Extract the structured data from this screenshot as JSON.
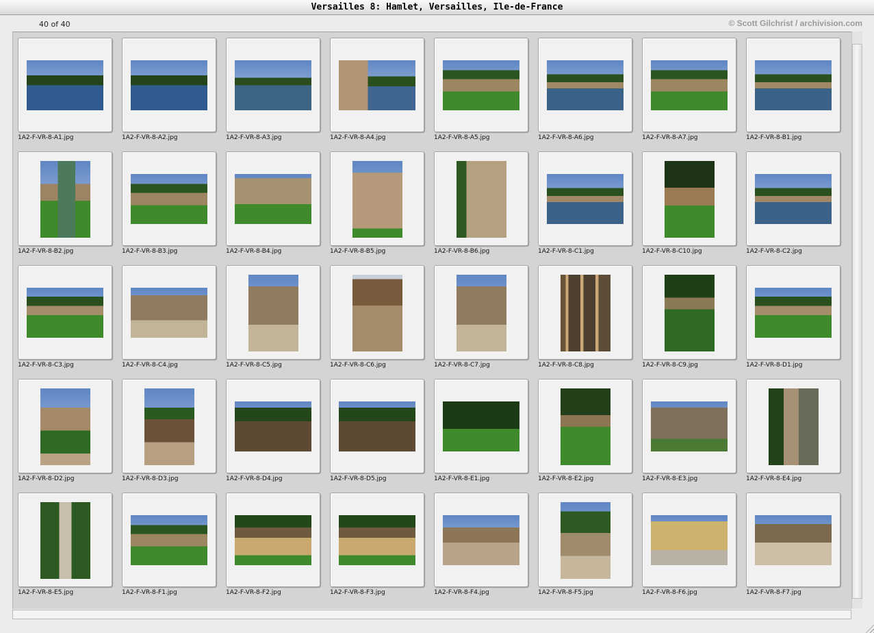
{
  "window": {
    "title": "Versailles 8: Hamlet, Versailles, Ile-de-France"
  },
  "header": {
    "count": "40 of 40",
    "credit": "© Scott Gilchrist / archivision.com"
  },
  "thumbnails": [
    {
      "file": "1A2-F-VR-8-A1.jpg",
      "orientation": "landscape",
      "scene": "lake-trees"
    },
    {
      "file": "1A2-F-VR-8-A2.jpg",
      "orientation": "landscape",
      "scene": "lake-trees"
    },
    {
      "file": "1A2-F-VR-8-A3.jpg",
      "orientation": "landscape",
      "scene": "lake-lilies"
    },
    {
      "file": "1A2-F-VR-8-A4.jpg",
      "orientation": "landscape",
      "scene": "path-lake"
    },
    {
      "file": "1A2-F-VR-8-A5.jpg",
      "orientation": "landscape",
      "scene": "lawn-cottage"
    },
    {
      "file": "1A2-F-VR-8-A6.jpg",
      "orientation": "landscape",
      "scene": "lake-cottage"
    },
    {
      "file": "1A2-F-VR-8-A7.jpg",
      "orientation": "landscape",
      "scene": "lawn-cottage"
    },
    {
      "file": "1A2-F-VR-8-B1.jpg",
      "orientation": "landscape",
      "scene": "lake-cottage"
    },
    {
      "file": "1A2-F-VR-8-B2.jpg",
      "orientation": "portrait",
      "scene": "canal-cottage"
    },
    {
      "file": "1A2-F-VR-8-B3.jpg",
      "orientation": "landscape",
      "scene": "lawn-cottage"
    },
    {
      "file": "1A2-F-VR-8-B4.jpg",
      "orientation": "landscape",
      "scene": "lawn-house"
    },
    {
      "file": "1A2-F-VR-8-B5.jpg",
      "orientation": "portrait",
      "scene": "house-facade"
    },
    {
      "file": "1A2-F-VR-8-B6.jpg",
      "orientation": "portrait",
      "scene": "house-stairs"
    },
    {
      "file": "1A2-F-VR-8-C1.jpg",
      "orientation": "landscape",
      "scene": "lake-cottage"
    },
    {
      "file": "1A2-F-VR-8-C10.jpg",
      "orientation": "portrait",
      "scene": "tree-stairs"
    },
    {
      "file": "1A2-F-VR-8-C2.jpg",
      "orientation": "landscape",
      "scene": "lake-cottage"
    },
    {
      "file": "1A2-F-VR-8-C3.jpg",
      "orientation": "landscape",
      "scene": "lawn-path"
    },
    {
      "file": "1A2-F-VR-8-C4.jpg",
      "orientation": "landscape",
      "scene": "gravel-house"
    },
    {
      "file": "1A2-F-VR-8-C5.jpg",
      "orientation": "portrait",
      "scene": "gravel-house"
    },
    {
      "file": "1A2-F-VR-8-C6.jpg",
      "orientation": "portrait",
      "scene": "gallery"
    },
    {
      "file": "1A2-F-VR-8-C7.jpg",
      "orientation": "portrait",
      "scene": "gravel-house"
    },
    {
      "file": "1A2-F-VR-8-C8.jpg",
      "orientation": "portrait",
      "scene": "timber"
    },
    {
      "file": "1A2-F-VR-8-C9.jpg",
      "orientation": "portrait",
      "scene": "ivy-tower"
    },
    {
      "file": "1A2-F-VR-8-D1.jpg",
      "orientation": "landscape",
      "scene": "lawn-path"
    },
    {
      "file": "1A2-F-VR-8-D2.jpg",
      "orientation": "portrait",
      "scene": "hedge-house"
    },
    {
      "file": "1A2-F-VR-8-D3.jpg",
      "orientation": "portrait",
      "scene": "gate-hedge"
    },
    {
      "file": "1A2-F-VR-8-D4.jpg",
      "orientation": "landscape",
      "scene": "garden-path"
    },
    {
      "file": "1A2-F-VR-8-D5.jpg",
      "orientation": "landscape",
      "scene": "garden-path"
    },
    {
      "file": "1A2-F-VR-8-E1.jpg",
      "orientation": "landscape",
      "scene": "lawn-trees"
    },
    {
      "file": "1A2-F-VR-8-E2.jpg",
      "orientation": "portrait",
      "scene": "woods-cottage"
    },
    {
      "file": "1A2-F-VR-8-E3.jpg",
      "orientation": "landscape",
      "scene": "stone-house"
    },
    {
      "file": "1A2-F-VR-8-E4.jpg",
      "orientation": "portrait",
      "scene": "tower-trees"
    },
    {
      "file": "1A2-F-VR-8-E5.jpg",
      "orientation": "portrait",
      "scene": "tower"
    },
    {
      "file": "1A2-F-VR-8-F1.jpg",
      "orientation": "landscape",
      "scene": "lawn-cottage"
    },
    {
      "file": "1A2-F-VR-8-F2.jpg",
      "orientation": "landscape",
      "scene": "thatch-house"
    },
    {
      "file": "1A2-F-VR-8-F3.jpg",
      "orientation": "landscape",
      "scene": "thatch-house"
    },
    {
      "file": "1A2-F-VR-8-F4.jpg",
      "orientation": "landscape",
      "scene": "fence-path"
    },
    {
      "file": "1A2-F-VR-8-F5.jpg",
      "orientation": "portrait",
      "scene": "courtyard"
    },
    {
      "file": "1A2-F-VR-8-F6.jpg",
      "orientation": "landscape",
      "scene": "yellow-house"
    },
    {
      "file": "1A2-F-VR-8-F7.jpg",
      "orientation": "landscape",
      "scene": "courtyard-well"
    }
  ]
}
